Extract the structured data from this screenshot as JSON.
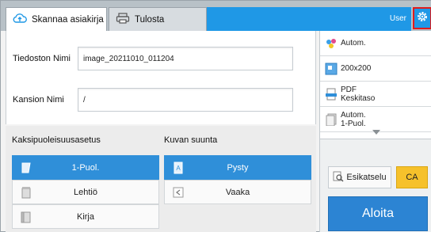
{
  "tabs": [
    {
      "label": "Skannaa asiakirja",
      "icon": "cloud-upload-icon",
      "active": true
    },
    {
      "label": "Tulosta",
      "icon": "printer-icon",
      "active": false
    }
  ],
  "header": {
    "user_label": "User",
    "settings_icon": "gear-icon"
  },
  "form": {
    "filename_label": "Tiedoston Nimi",
    "filename_value": "image_20211010_011204",
    "folder_label": "Kansion Nimi",
    "folder_value": "/"
  },
  "duplex": {
    "title": "Kaksipuoleisuusasetus",
    "options": [
      {
        "label": "1-Puol.",
        "icon": "one-sided-icon",
        "selected": true
      },
      {
        "label": "Lehtiö",
        "icon": "tablet-binding-icon",
        "selected": false
      },
      {
        "label": "Kirja",
        "icon": "book-binding-icon",
        "selected": false
      }
    ]
  },
  "orientation": {
    "title": "Kuvan suunta",
    "options": [
      {
        "label": "Pysty",
        "icon": "portrait-icon",
        "selected": true
      },
      {
        "label": "Vaaka",
        "icon": "landscape-icon",
        "selected": false
      }
    ]
  },
  "settings_panel": {
    "items": [
      {
        "text": "Autom.",
        "icon": "color-mode-icon"
      },
      {
        "text": "200x200",
        "icon": "resolution-icon"
      },
      {
        "text_line1": "PDF",
        "text_line2": "Keskitaso",
        "icon": "file-format-icon"
      },
      {
        "text_line1": "Autom.",
        "text_line2": "1-Puol.",
        "icon": "original-size-icon"
      }
    ],
    "more_icon": "chevron-down-icon"
  },
  "actions": {
    "preview_label": "Esikatselu",
    "ca_label": "CA",
    "start_label": "Aloita"
  },
  "colors": {
    "accent_blue": "#1f98e6",
    "selected_blue": "#2f8fd9",
    "start_blue": "#2c84d3",
    "ca_yellow": "#f6c12b",
    "highlight_red": "#e11b1b"
  }
}
